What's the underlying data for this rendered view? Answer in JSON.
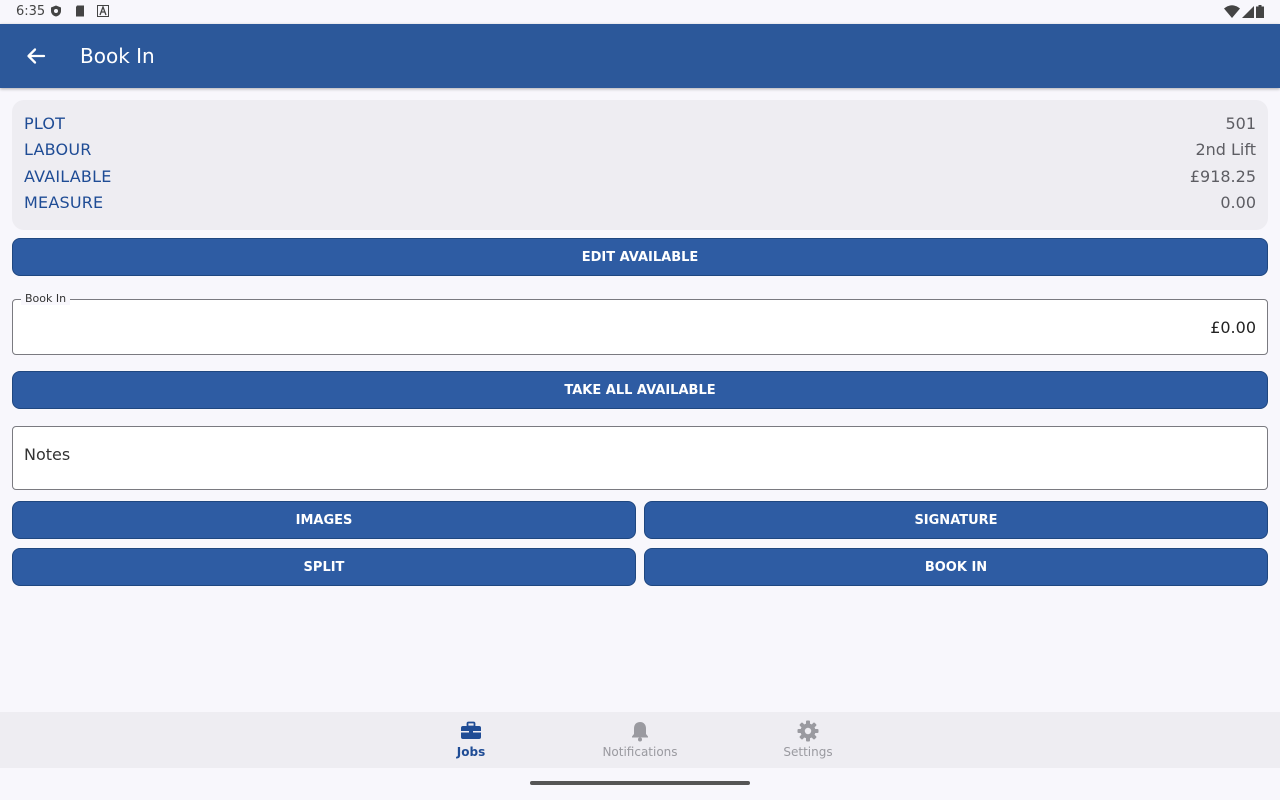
{
  "status": {
    "time": "6:35"
  },
  "header": {
    "title": "Book In"
  },
  "info": [
    {
      "label": "PLOT",
      "value": "501"
    },
    {
      "label": "LABOUR",
      "value": "2nd Lift"
    },
    {
      "label": "AVAILABLE",
      "value": "£918.25"
    },
    {
      "label": "MEASURE",
      "value": "0.00"
    }
  ],
  "buttons": {
    "edit_available": "EDIT AVAILABLE",
    "take_all": "TAKE ALL AVAILABLE",
    "images": "IMAGES",
    "signature": "SIGNATURE",
    "split": "SPLIT",
    "book_in": "BOOK IN"
  },
  "book_in_field": {
    "label": "Book In",
    "value": "£0.00"
  },
  "notes_field": {
    "placeholder": "Notes"
  },
  "nav": {
    "items": [
      {
        "label": "Jobs",
        "icon": "briefcase-icon",
        "active": true
      },
      {
        "label": "Notifications",
        "icon": "bell-icon",
        "active": false
      },
      {
        "label": "Settings",
        "icon": "gear-icon",
        "active": false
      }
    ]
  },
  "colors": {
    "primary": "#2c589a",
    "label": "#1f4c95",
    "card_bg": "#eeedf2",
    "page_bg": "#f8f7fc"
  }
}
